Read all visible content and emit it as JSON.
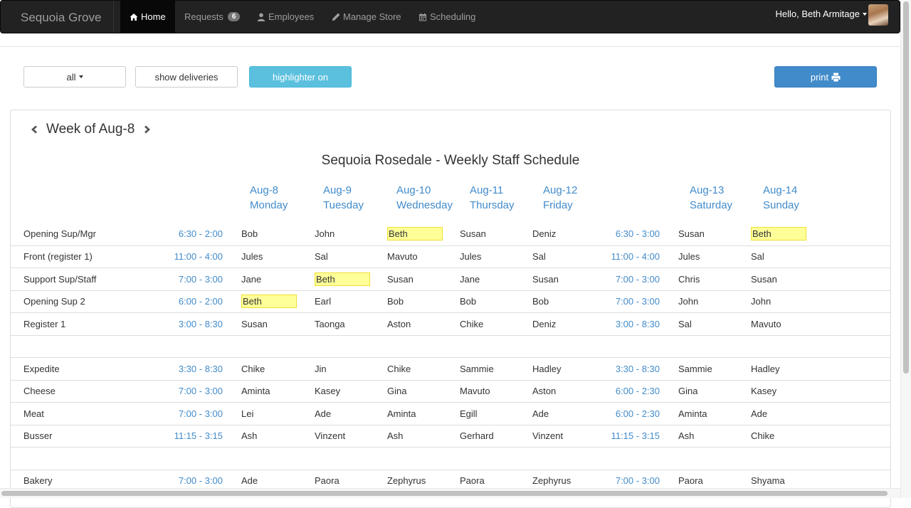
{
  "navbar": {
    "brand": "Sequoia Grove",
    "items": [
      {
        "label": "Home",
        "icon": "home-icon"
      },
      {
        "label": "Requests",
        "badge": "6"
      },
      {
        "label": "Employees",
        "icon": "user-icon"
      },
      {
        "label": "Manage Store",
        "icon": "pencil-icon"
      },
      {
        "label": "Scheduling",
        "icon": "calendar-icon"
      }
    ],
    "user_greeting": "Hello, Beth Armitage"
  },
  "toolbar": {
    "filter_label": "all",
    "deliveries_label": "show deliveries",
    "highlighter_label": "highlighter on",
    "print_label": "print"
  },
  "schedule": {
    "week_label": "Week of Aug-8",
    "title": "Sequoia Rosedale - Weekly Staff Schedule",
    "days": [
      {
        "date": "Aug-8",
        "name": "Monday"
      },
      {
        "date": "Aug-9",
        "name": "Tuesday"
      },
      {
        "date": "Aug-10",
        "name": "Wednesday"
      },
      {
        "date": "Aug-11",
        "name": "Thursday"
      },
      {
        "date": "Aug-12",
        "name": "Friday"
      },
      {
        "date": "Aug-13",
        "name": "Saturday"
      },
      {
        "date": "Aug-14",
        "name": "Sunday"
      }
    ],
    "highlight_color": "#ffff99",
    "rows": [
      {
        "role": "Opening Sup/Mgr",
        "weekday_time": "6:30 - 2:00",
        "weekend_time": "6:30 - 3:00",
        "staff": [
          "Bob",
          "John",
          "Beth",
          "Susan",
          "Deniz",
          "Susan",
          "Beth"
        ],
        "highlight": [
          2,
          6
        ]
      },
      {
        "role": "Front (register 1)",
        "weekday_time": "11:00 - 4:00",
        "weekend_time": "11:00 - 4:00",
        "staff": [
          "Jules",
          "Sal",
          "Mavuto",
          "Jules",
          "Sal",
          "Jules",
          "Sal"
        ],
        "highlight": []
      },
      {
        "role": "Support Sup/Staff",
        "weekday_time": "7:00 - 3:00",
        "weekend_time": "7:00 - 3:00",
        "staff": [
          "Jane",
          "Beth",
          "Susan",
          "Jane",
          "Susan",
          "Chris",
          "Susan"
        ],
        "highlight": [
          1
        ]
      },
      {
        "role": "Opening Sup 2",
        "weekday_time": "6:00 - 2:00",
        "weekend_time": "7:00 - 3:00",
        "staff": [
          "Beth",
          "Earl",
          "Bob",
          "Bob",
          "Bob",
          "John",
          "John"
        ],
        "highlight": [
          0
        ]
      },
      {
        "role": "Register 1",
        "weekday_time": "3:00 - 8:30",
        "weekend_time": "3:00 - 8:30",
        "staff": [
          "Susan",
          "Taonga",
          "Aston",
          "Chike",
          "Deniz",
          "Sal",
          "Mavuto"
        ],
        "highlight": []
      },
      {
        "role": "",
        "weekday_time": "",
        "weekend_time": "",
        "staff": [
          "",
          "",
          "",
          "",
          "",
          "",
          ""
        ],
        "highlight": []
      },
      {
        "role": "Expedite",
        "weekday_time": "3:30 - 8:30",
        "weekend_time": "3:30 - 8:30",
        "staff": [
          "Chike",
          "Jin",
          "Chike",
          "Sammie",
          "Hadley",
          "Sammie",
          "Hadley"
        ],
        "highlight": []
      },
      {
        "role": "Cheese",
        "weekday_time": "7:00 - 3:00",
        "weekend_time": "6:00 - 2:30",
        "staff": [
          "Aminta",
          "Kasey",
          "Gina",
          "Mavuto",
          "Aston",
          "Gina",
          "Kasey"
        ],
        "highlight": []
      },
      {
        "role": "Meat",
        "weekday_time": "7:00 - 3:00",
        "weekend_time": "6:00 - 2:30",
        "staff": [
          "Lei",
          "Ade",
          "Aminta",
          "Egill",
          "Ade",
          "Aminta",
          "Ade"
        ],
        "highlight": []
      },
      {
        "role": "Busser",
        "weekday_time": "11:15 - 3:15",
        "weekend_time": "11:15 - 3:15",
        "staff": [
          "Ash",
          "Vinzent",
          "Ash",
          "Gerhard",
          "Vinzent",
          "Ash",
          "Chike"
        ],
        "highlight": []
      },
      {
        "role": "",
        "weekday_time": "",
        "weekend_time": "",
        "staff": [
          "",
          "",
          "",
          "",
          "",
          "",
          ""
        ],
        "highlight": []
      },
      {
        "role": "Bakery",
        "weekday_time": "7:00 - 3:00",
        "weekend_time": "7:00 - 3:00",
        "staff": [
          "Ade",
          "Paora",
          "Zephyrus",
          "Paora",
          "Zephyrus",
          "Paora",
          "Shyama"
        ],
        "highlight": []
      }
    ]
  }
}
